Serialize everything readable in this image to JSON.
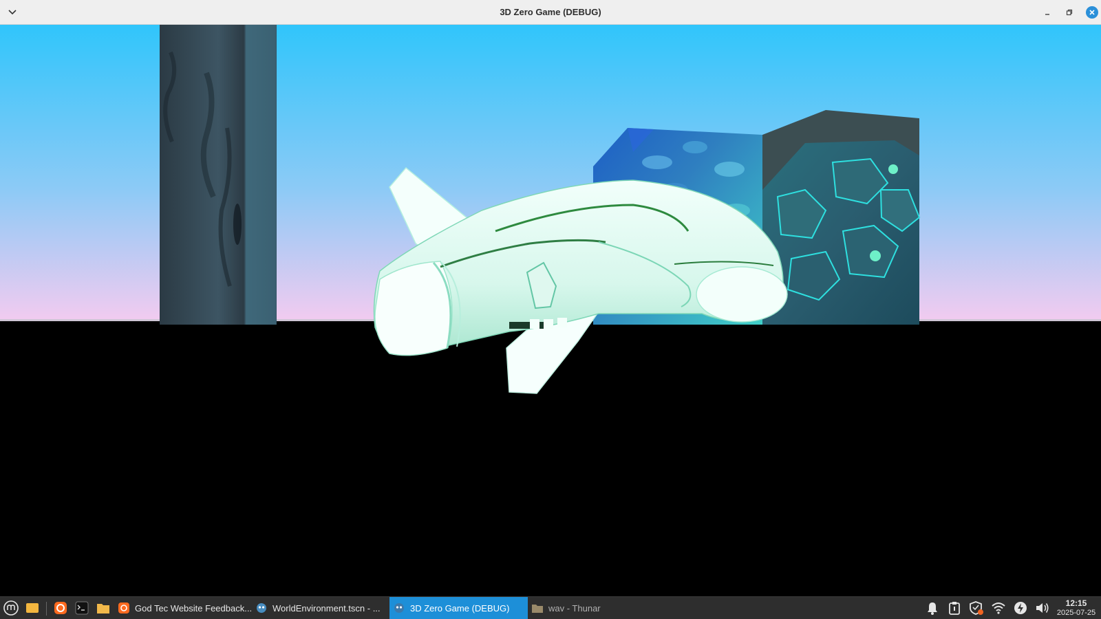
{
  "window": {
    "title": "3D Zero  Game (DEBUG)",
    "menu_icon": "chevron-down-icon",
    "minimize_icon": "minimize-icon",
    "restore_icon": "restore-icon",
    "close_icon": "close-icon"
  },
  "scene": {
    "sky_top": "#32c6fb",
    "sky_bottom": "#f1c8ee",
    "ground": "#000000",
    "ship_color": "#e9fbf6"
  },
  "taskbar": {
    "launchers": [
      "mint-menu-icon",
      "show-desktop-icon",
      "firefox-icon",
      "terminal-icon",
      "file-manager-icon"
    ],
    "tasks": [
      {
        "label": "God Tec Website Feedback...",
        "icon": "firefox-icon"
      },
      {
        "label": "WorldEnvironment.tscn - ...",
        "icon": "godot-icon"
      },
      {
        "label": "3D Zero  Game (DEBUG)",
        "icon": "godot-icon"
      },
      {
        "label": "wav - Thunar",
        "icon": "folder-icon"
      }
    ],
    "tray": [
      "notifications-icon",
      "clipboard-icon",
      "shield-icon",
      "wifi-icon",
      "power-icon",
      "volume-icon"
    ],
    "clock_time": "12:15",
    "clock_date": "2025-07-25"
  }
}
